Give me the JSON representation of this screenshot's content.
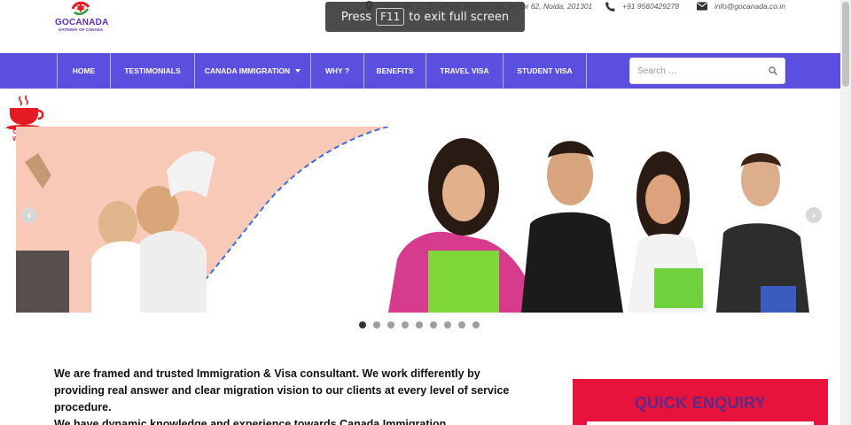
{
  "header": {
    "logo_brand": "GOCANADA",
    "logo_tagline": "GATEWAY OF CANADA",
    "address": "Office No. 1126, I-Thum Tower, A-40, Sector 62, Noida, 201301",
    "phone": "+91 9560429278",
    "email": "info@gocanada.co.in"
  },
  "fullscreen_toast": {
    "prefix": "Press",
    "key": "F11",
    "suffix": "to exit full screen"
  },
  "nav": {
    "items": [
      {
        "label": "HOME"
      },
      {
        "label": "TESTIMONIALS"
      },
      {
        "label": "CANADA IMMIGRATION"
      },
      {
        "label": "WHY ?"
      },
      {
        "label": "BENEFITS"
      },
      {
        "label": "TRAVEL VISA"
      },
      {
        "label": "STUDENT VISA"
      }
    ],
    "search_placeholder": "Search …"
  },
  "coffee_badge": {
    "line1": "COFFEE",
    "line2": "WITH US"
  },
  "slider": {
    "slide_count": 9,
    "active_index": 0
  },
  "intro": {
    "line1": "We are framed and trusted Immigration & Visa consultant. We work differently by",
    "line2": "providing real answer and clear migration vision to our clients at every level of service",
    "line3": "procedure.",
    "line4": "We have dynamic knowledge and experience towards Canada Immigration"
  },
  "enquiry": {
    "title": "QUICK ENQUIRY"
  },
  "colors": {
    "nav_bg": "#5b4fe0",
    "enquiry_bg": "#e8133c",
    "brand_purple": "#5b2fb8"
  }
}
